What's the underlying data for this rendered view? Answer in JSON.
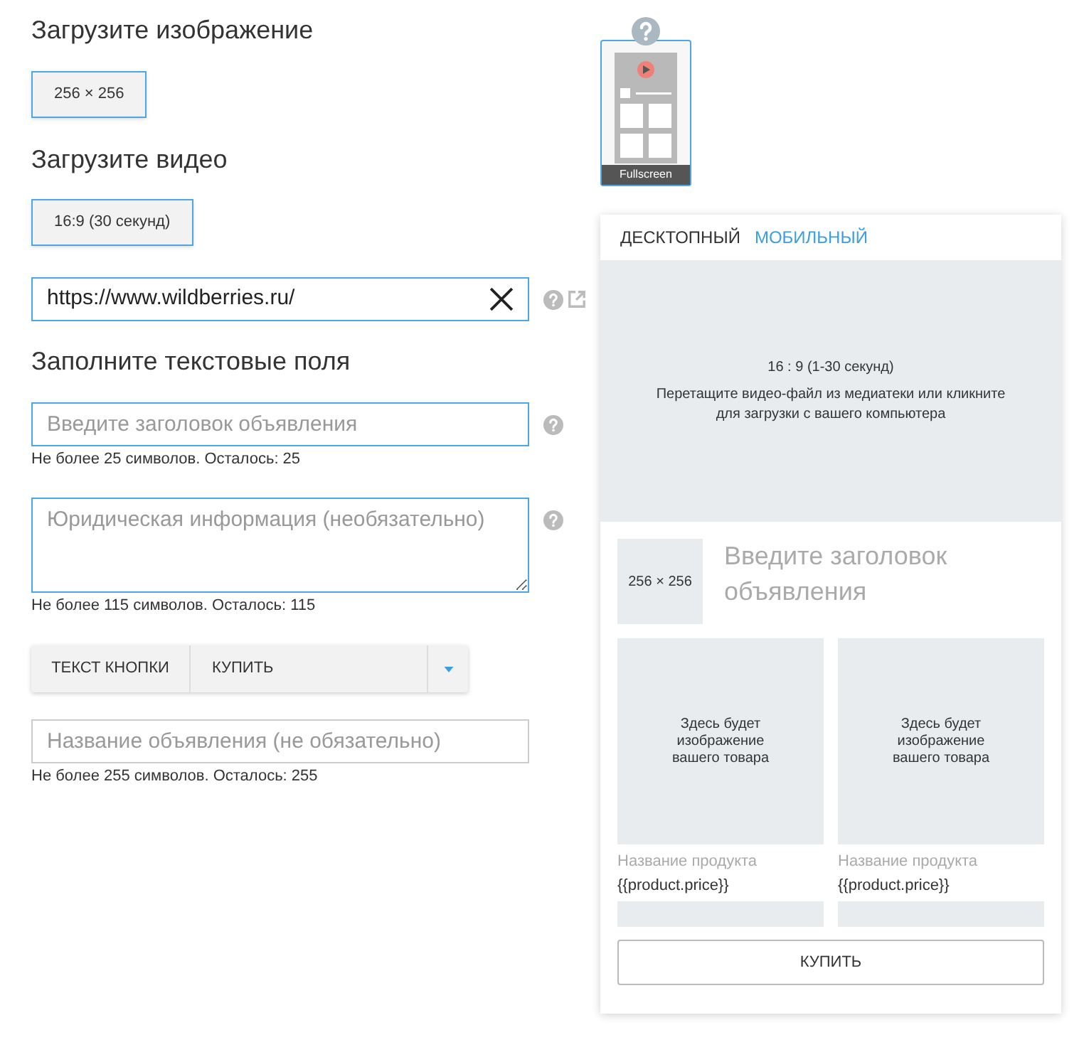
{
  "left": {
    "image_heading": "Загрузите изображение",
    "image_button": "256 × 256",
    "video_heading": "Загрузите видео",
    "video_button": "16:9 (30 секунд)",
    "url_field": {
      "value": "https://www.wildberries.ru/"
    },
    "text_heading": "Заполните текстовые поля",
    "fields": [
      {
        "kind": "input",
        "placeholder": "Введите заголовок объявления",
        "hint": "Не более 25 символов. Осталось: 25",
        "help": true,
        "focused": true
      },
      {
        "kind": "textarea",
        "placeholder": "Юридическая информация (необязательно)",
        "hint": "Не более 115 символов. Осталось: 115",
        "help": true,
        "focused": true
      },
      {
        "kind": "button_text",
        "label": "ТЕКСТ КНОПКИ",
        "value": "КУПИТЬ"
      },
      {
        "kind": "input",
        "placeholder": "Название объявления (не обязательно)",
        "hint": "Не более 255 символов. Осталось: 255",
        "help": false,
        "focused": false
      }
    ]
  },
  "format": {
    "label": "Fullscreen",
    "selected": true
  },
  "preview": {
    "tabs": [
      {
        "label": "ДЕСКТОПНЫЙ",
        "selected": false
      },
      {
        "label": "МОБИЛЬНЫЙ",
        "selected": true
      }
    ],
    "video": {
      "ratio": "16 : 9 (1-30 секунд)",
      "hint": "Перетащите видео-файл из медиатеки или кликните для загрузки с вашего компьютера"
    },
    "logo": "256 × 256",
    "headline": "Введите заголовок объявления",
    "products": [
      {
        "image_text": "Здесь будет изображение вашего товара",
        "name": "Название продукта",
        "price": "{{product.price}}"
      },
      {
        "image_text": "Здесь будет изображение вашего товара",
        "name": "Название продукта",
        "price": "{{product.price}}"
      }
    ],
    "button": "КУПИТЬ"
  }
}
